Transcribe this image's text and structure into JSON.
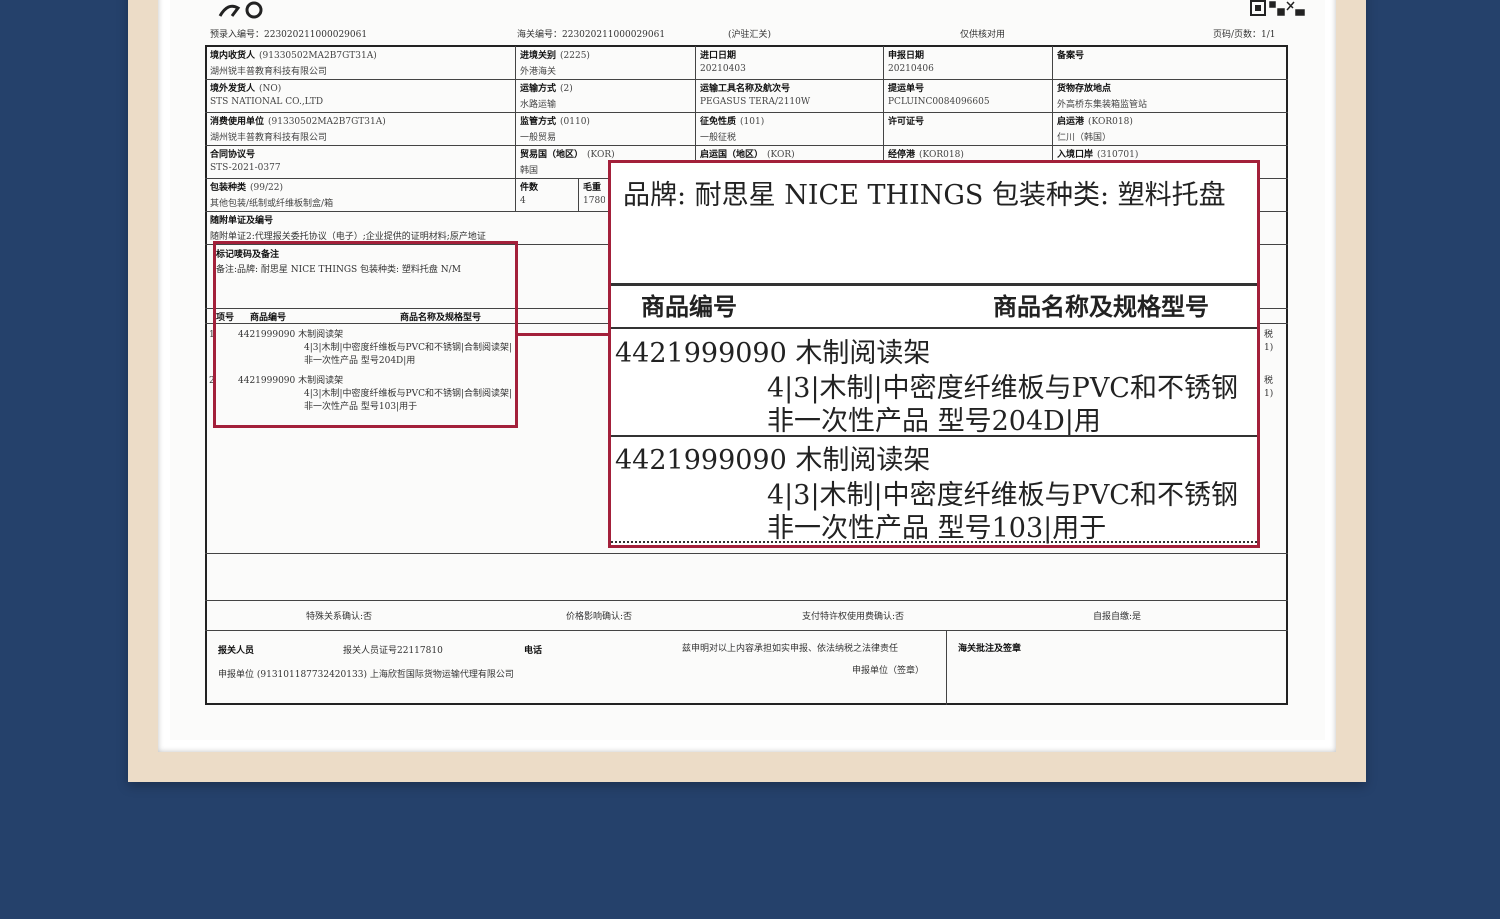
{
  "header": {
    "prelim_no": "预录入编号：223020211000029061",
    "customs_no": "海关编号：223020211000029061",
    "customs_branch": "(沪驻汇关)",
    "note": "仅供核对用",
    "page": "页码/页数：1/1"
  },
  "fields": [
    {
      "label": "境内收货人",
      "code": "(91330502MA2B7GT31A)",
      "value": "湖州锐丰普教育科技有限公司"
    },
    {
      "label": "进境关别",
      "code": "(2225)",
      "value": "外港海关"
    },
    {
      "label": "进口日期",
      "code": "",
      "value": "20210403"
    },
    {
      "label": "申报日期",
      "code": "",
      "value": "20210406"
    },
    {
      "label": "备案号",
      "code": "",
      "value": ""
    },
    {
      "label": "境外发货人",
      "code": "(NO)",
      "value": "STS NATIONAL CO.,LTD"
    },
    {
      "label": "运输方式",
      "code": "(2)",
      "value": "水路运输"
    },
    {
      "label": "运输工具名称及航次号",
      "code": "",
      "value": "PEGASUS TERA/2110W"
    },
    {
      "label": "提运单号",
      "code": "",
      "value": "PCLUINC0084096605"
    },
    {
      "label": "货物存放地点",
      "code": "",
      "value": "外高桥东集装箱监管站"
    },
    {
      "label": "消费使用单位",
      "code": "(91330502MA2B7GT31A)",
      "value": "湖州锐丰普教育科技有限公司"
    },
    {
      "label": "监管方式",
      "code": "(0110)",
      "value": "一般贸易"
    },
    {
      "label": "征免性质",
      "code": "(101)",
      "value": "一般征税"
    },
    {
      "label": "许可证号",
      "code": "",
      "value": ""
    },
    {
      "label": "启运港",
      "code": "(KOR018)",
      "value": "仁川（韩国）"
    },
    {
      "label": "合同协议号",
      "code": "",
      "value": "STS-2021-0377"
    },
    {
      "label": "贸易国（地区）",
      "code": "(KOR)",
      "value": "韩国"
    },
    {
      "label": "启运国（地区）",
      "code": "(KOR)",
      "value": ""
    },
    {
      "label": "经停港",
      "code": "(KOR018)",
      "value": ""
    },
    {
      "label": "入境口岸",
      "code": "(310701)",
      "value": ""
    },
    {
      "label": "包装种类",
      "code": "(99/22)",
      "value": "其他包装/纸制或纤维板制盒/箱"
    },
    {
      "label": "件数",
      "code": "",
      "value": "4"
    },
    {
      "label": "毛重",
      "code": "",
      "value": "1780"
    }
  ],
  "attached_docs_label": "随附单证及编号",
  "attached_docs_value": "随附单证2:代理报关委托协议（电子）;企业提供的证明材料;原产地证",
  "marks_label": "标记唛码及备注",
  "marks_value": "备注:品牌: 耐思星 NICE THINGS 包装种类: 塑料托盘 N/M",
  "goods_header": {
    "no": "项号",
    "code": "商品编号",
    "name": "商品名称及规格型号"
  },
  "goods_small": [
    {
      "no": "1",
      "line1": "4421999090 木制阅读架",
      "line2": "4|3|木制|中密度纤维板与PVC和不锈钢|合制阅读架|",
      "line3": "非一次性产品 型号204D|用"
    },
    {
      "no": "2",
      "line1": "4421999090 木制阅读架",
      "line2": "4|3|木制|中密度纤维板与PVC和不锈钢|合制阅读架|",
      "line3": "非一次性产品 型号103|用于"
    }
  ],
  "right_edge": [
    "税",
    "1)",
    "税",
    "1)"
  ],
  "zoom": {
    "remark": "品牌:  耐思星  NICE  THINGS  包装种类:  塑料托盘",
    "col_code": "商品编号",
    "col_name": "商品名称及规格型号",
    "items": [
      {
        "line1": "4421999090 木制阅读架",
        "line2": "4|3|木制|中密度纤维板与PVC和不锈钢",
        "line3": "非一次性产品  型号204D|用"
      },
      {
        "line1": "4421999090 木制阅读架",
        "line2": "4|3|木制|中密度纤维板与PVC和不锈钢",
        "line3": "非一次性产品  型号103|用于"
      }
    ]
  },
  "confirm": {
    "special": "特殊关系确认:否",
    "price": "价格影响确认:否",
    "royalty": "支付特许权使用费确认:否",
    "self": "自报自缴:是"
  },
  "footer": {
    "broker": "报关人员",
    "broker_cert": "报关人员证号22117810",
    "phone": "电话",
    "declaration": "兹申明对以上内容承担如实申报、依法纳税之法律责任",
    "declarant_seal": "申报单位（签章）",
    "unit": "申报单位 (913101187732420133) 上海欣哲国际货物运输代理有限公司",
    "customs_seal": "海关批注及签章"
  }
}
